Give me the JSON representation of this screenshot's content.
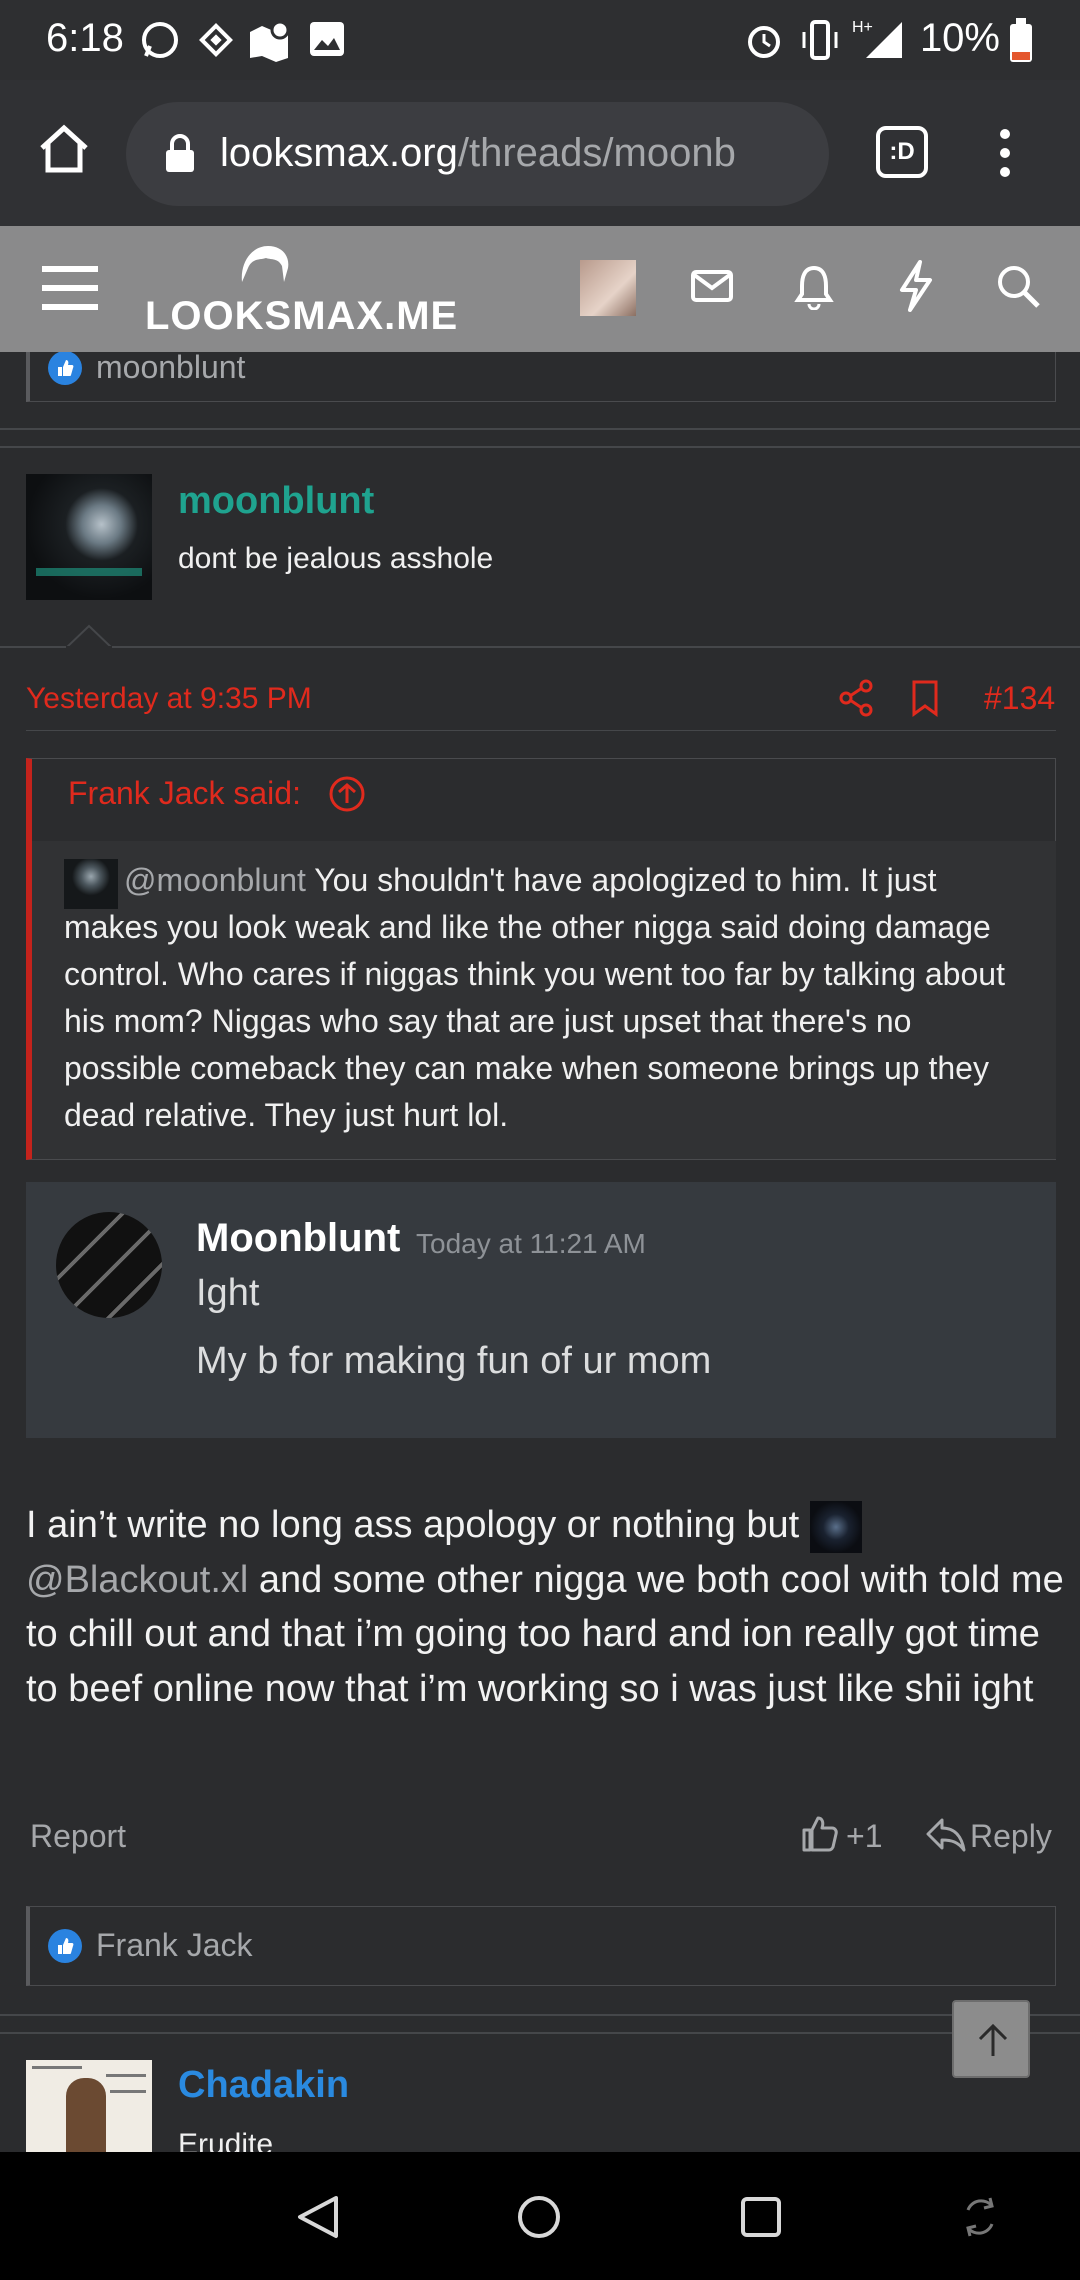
{
  "status_bar": {
    "time": "6:18",
    "battery": "10%",
    "icons": [
      "whatsapp-icon",
      "binance-icon",
      "maps-icon",
      "gallery-icon",
      "alarm-icon",
      "vibrate-icon",
      "signal-icon",
      "battery-icon"
    ]
  },
  "browser": {
    "url_domain": "looksmax.org",
    "url_path": "/threads/moonb",
    "tab_badge": ":D"
  },
  "site": {
    "logo_text": "LOOKSMAX.ME"
  },
  "top_reaction": {
    "name": "moonblunt"
  },
  "post": {
    "author": "moonblunt",
    "author_title": "dont be jealous asshole",
    "date": "Yesterday at 9:35 PM",
    "number": "#134",
    "quote": {
      "header": "Frank Jack said:",
      "mention": "@moonblunt",
      "text": "You shouldn't have apologized to him. It just makes you look weak and like the other nigga said doing damage control. Who cares if niggas think you went too far by talking about his mom? Niggas who say that are just upset that there's no possible comeback they can make when someone brings up they dead relative. They just hurt lol."
    },
    "discord": {
      "name": "Moonblunt",
      "timestamp": "Today at 11:21 AM",
      "line1": "Ight",
      "line2": "My b for making fun of ur mom"
    },
    "body_part1": "I ain’t write no long ass apology or nothing but",
    "body_mention": "@Blackout.xl",
    "body_part2": "and some other nigga we both cool with told me to chill out and that i’m going too hard and ion really got time to beef online now that i’m working so i was just like shii ight",
    "report_label": "Report",
    "like_count": "+1",
    "reply_label": "Reply",
    "reaction_name": "Frank Jack"
  },
  "next_post": {
    "author": "Chadakin",
    "author_title": "Erudite"
  },
  "colors": {
    "accent_red": "#e02a1d",
    "username_teal": "#1fa38f",
    "username_blue": "#2a8ae0",
    "header_gray": "#8a8a8b"
  }
}
